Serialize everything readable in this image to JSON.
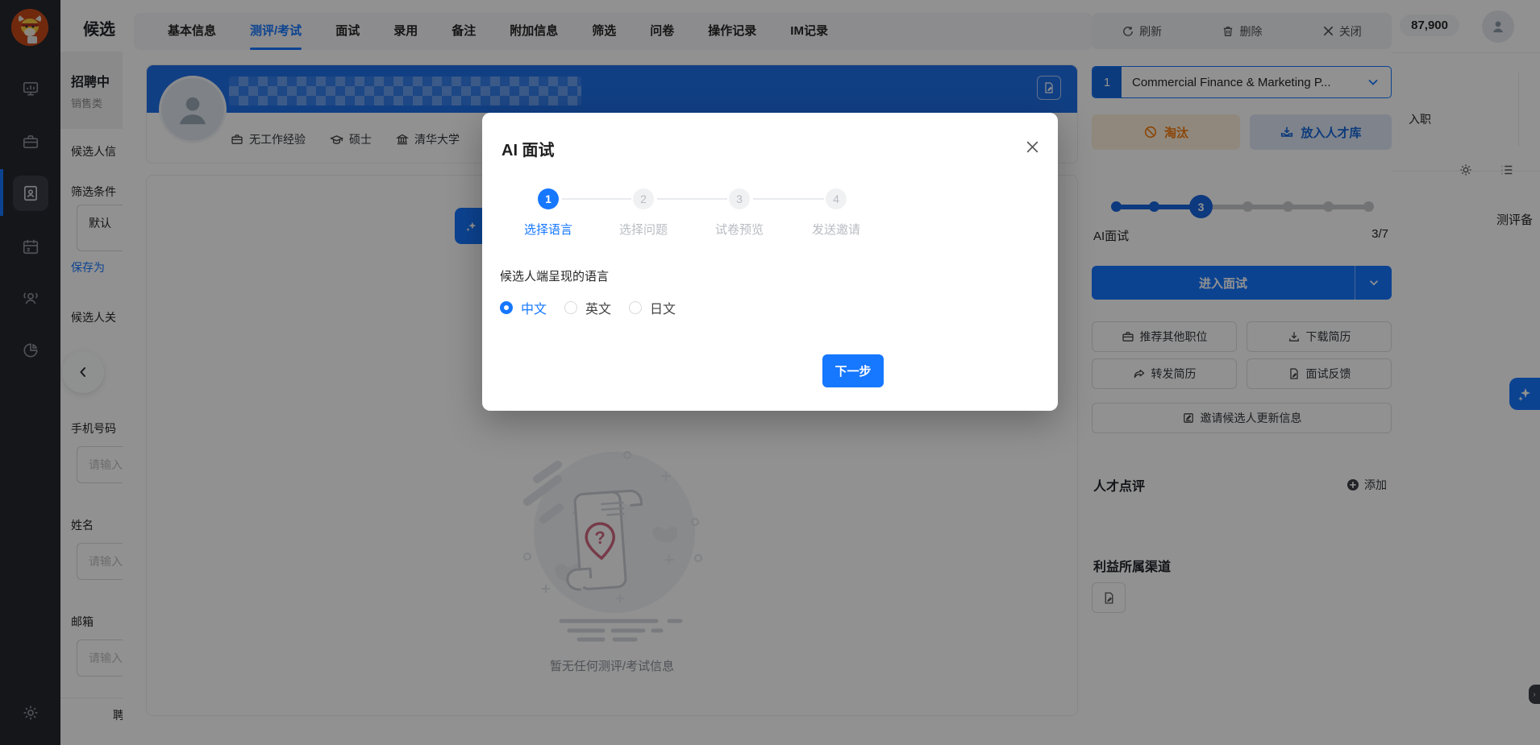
{
  "colors": {
    "primary": "#1677ff",
    "header_blue": "#1e6fe8",
    "warn_orange": "#f57c0f",
    "sidebar_bg": "#26282e",
    "mask": "rgba(0,0,0,0.43)"
  },
  "sidebar": {
    "icons": [
      "dashboard-monitor",
      "jobs-briefcase",
      "resume-card",
      "calendar",
      "contacts-group",
      "pie-chart"
    ],
    "footer_icon": "settings-gear",
    "active_index": 2
  },
  "base_page": {
    "window_title": "候选",
    "topbar": {
      "count": "87,900"
    },
    "filter_panel": {
      "section_title": "招聘中",
      "section_subtitle": "销售类",
      "label_candidate_info": "候选人信",
      "label_filter": "筛选条件",
      "select_value": "默认",
      "save_link": "保存为",
      "label_keyword": "候选人关",
      "fields": [
        {
          "label": "手机号码",
          "placeholder": "请输入"
        },
        {
          "label": "姓名",
          "placeholder": "请输入"
        },
        {
          "label": "邮箱",
          "placeholder": "请输入"
        }
      ],
      "bottom_partial": "聘"
    },
    "right_column": {
      "stage_partial": "入职",
      "note_partial": "测评备"
    }
  },
  "drawer": {
    "tabs": [
      {
        "label": "基本信息"
      },
      {
        "label": "测评/考试"
      },
      {
        "label": "面试"
      },
      {
        "label": "录用"
      },
      {
        "label": "备注"
      },
      {
        "label": "附加信息"
      },
      {
        "label": "筛选"
      },
      {
        "label": "问卷"
      },
      {
        "label": "操作记录"
      },
      {
        "label": "IM记录"
      }
    ],
    "candidate": {
      "meta": [
        {
          "icon": "briefcase-icon",
          "text": "无工作经验"
        },
        {
          "icon": "graduation-cap-icon",
          "text": "硕士"
        },
        {
          "icon": "university-icon",
          "text": "清华大学"
        }
      ]
    },
    "empty_state": {
      "caption": "暂无任何测评/考试信息"
    },
    "actions_bar": [
      {
        "icon": "refresh-icon",
        "label": "刷新"
      },
      {
        "icon": "trash-icon",
        "label": "删除"
      },
      {
        "icon": "close-icon",
        "label": "关闭"
      }
    ],
    "right_panel": {
      "job_selector": {
        "index": "1",
        "value": "Commercial Finance & Marketing P..."
      },
      "reject_button": "淘汰",
      "talent_pool_button": "放入人才库",
      "stage": {
        "label": "AI面试",
        "progress": "3/7",
        "current_step_number": "3"
      },
      "enter_button": "进入面试",
      "buttons": [
        {
          "icon": "briefcase-icon",
          "label": "推荐其他职位"
        },
        {
          "icon": "download-icon",
          "label": "下载简历"
        },
        {
          "icon": "forward-icon",
          "label": "转发简历"
        },
        {
          "icon": "feedback-doc-icon",
          "label": "面试反馈"
        },
        {
          "icon": "edit-doc-icon",
          "label": "邀请候选人更新信息"
        }
      ],
      "review": {
        "title": "人才点评",
        "add_label": "添加"
      },
      "channel": {
        "title": "利益所属渠道"
      }
    }
  },
  "modal": {
    "title": "AI 面试",
    "steps": [
      {
        "num": "1",
        "label": "选择语言"
      },
      {
        "num": "2",
        "label": "选择问题"
      },
      {
        "num": "3",
        "label": "试卷预览"
      },
      {
        "num": "4",
        "label": "发送邀请"
      }
    ],
    "question_label": "候选人端呈现的语言",
    "options": [
      {
        "label": "中文",
        "selected": true
      },
      {
        "label": "英文",
        "selected": false
      },
      {
        "label": "日文",
        "selected": false
      }
    ],
    "next_button": "下一步"
  }
}
